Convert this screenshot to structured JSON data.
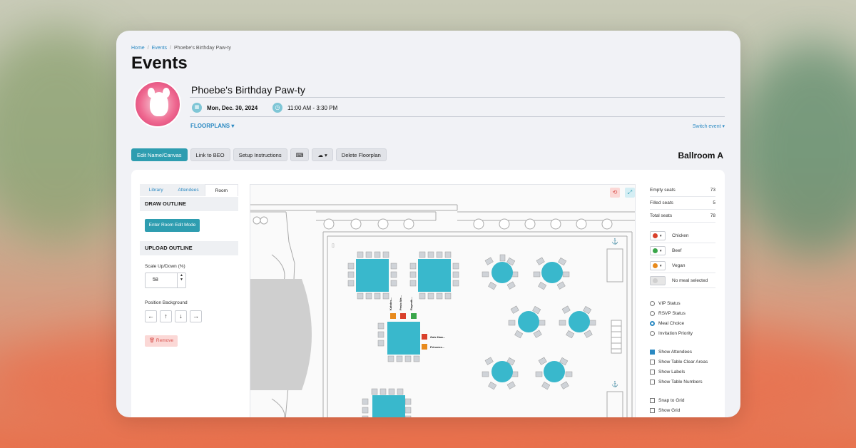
{
  "breadcrumb": {
    "home": "Home",
    "events": "Events",
    "current": "Phoebe's Birthday Paw-ty"
  },
  "page_title": "Events",
  "event": {
    "name": "Phoebe's Birthday Paw-ty",
    "date": "Mon, Dec. 30, 2024",
    "time": "11:00 AM - 3:30 PM",
    "floorplans_label": "FLOORPLANS",
    "switch_event": "Switch event"
  },
  "toolbar": {
    "edit": "Edit Name/Canvas",
    "link_beo": "Link to BEO",
    "setup": "Setup Instructions",
    "delete": "Delete Floorplan"
  },
  "room_title": "Ballroom A",
  "left_panel": {
    "tabs": [
      "Library",
      "Attendees",
      "Room"
    ],
    "active_tab": "Room",
    "draw_outline": "DRAW OUTLINE",
    "enter_edit_mode": "Enter Room Edit Mode",
    "upload_outline": "UPLOAD OUTLINE",
    "scale_label": "Scale Up/Down (%)",
    "scale_value": "58",
    "position_bg": "Position Background",
    "remove": "Remove"
  },
  "canvas_labels": {
    "seat_top": [
      "Katniss...",
      "Pesto Me...",
      "Rayenik..."
    ],
    "seat_right": [
      "Gale Haw...",
      "Princess..."
    ]
  },
  "seats": [
    {
      "label": "Empty seats",
      "value": "73"
    },
    {
      "label": "Filled seats",
      "value": "5"
    },
    {
      "label": "Total seats",
      "value": "78"
    }
  ],
  "meals": [
    {
      "label": "Chicken",
      "color": "#d9402b"
    },
    {
      "label": "Beef",
      "color": "#3aa64a"
    },
    {
      "label": "Vegan",
      "color": "#e88a1c"
    },
    {
      "label": "No meal selected",
      "color": "#cfcfcf"
    }
  ],
  "view_options": [
    {
      "label": "VIP Status",
      "selected": false
    },
    {
      "label": "RSVP Status",
      "selected": false
    },
    {
      "label": "Meal Choice",
      "selected": true
    },
    {
      "label": "Invitation Priority",
      "selected": false
    }
  ],
  "show_options": [
    {
      "label": "Show Attendees",
      "checked": true
    },
    {
      "label": "Show Table Clear Areas",
      "checked": false
    },
    {
      "label": "Show Labels",
      "checked": false
    },
    {
      "label": "Show Table Numbers",
      "checked": false
    }
  ],
  "grid_options": [
    {
      "label": "Snap to Grid",
      "checked": false
    },
    {
      "label": "Show Grid",
      "checked": false
    }
  ]
}
